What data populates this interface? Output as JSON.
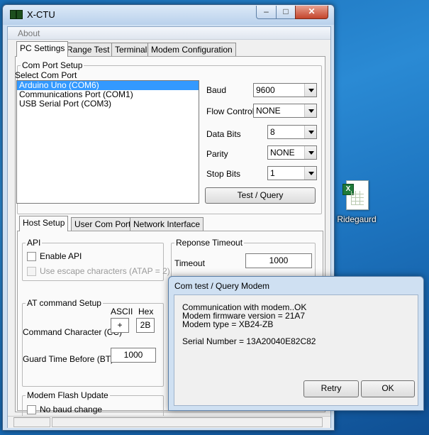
{
  "window": {
    "title": "X-CTU",
    "min_glyph": "–",
    "max_glyph": "□",
    "close_glyph": "✕"
  },
  "menu": {
    "about": "About"
  },
  "tabs": [
    "PC Settings",
    "Range Test",
    "Terminal",
    "Modem Configuration"
  ],
  "com_port_setup": {
    "legend": "Com Port Setup",
    "select_label": "Select Com Port",
    "ports": [
      "Arduino Uno (COM6)",
      "Communications Port (COM1)",
      "USB Serial Port (COM3)"
    ],
    "baud_label": "Baud",
    "baud_value": "9600",
    "flow_label": "Flow Control",
    "flow_value": "NONE",
    "databits_label": "Data Bits",
    "databits_value": "8",
    "parity_label": "Parity",
    "parity_value": "NONE",
    "stopbits_label": "Stop Bits",
    "stopbits_value": "1",
    "test_button": "Test  / Query"
  },
  "subtabs": [
    "Host Setup",
    "User Com Ports",
    "Network Interface"
  ],
  "api": {
    "legend": "API",
    "enable_api": "Enable API",
    "escape_chars": "Use escape characters (ATAP = 2)"
  },
  "response_timeout": {
    "legend": "Reponse Timeout",
    "timeout_label": "Timeout",
    "timeout_value": "1000"
  },
  "at_command": {
    "legend": "AT command Setup",
    "ascii_label": "ASCII",
    "hex_label": "Hex",
    "cc_label": "Command Character (CC)",
    "cc_ascii": "+",
    "cc_hex": "2B",
    "bt_label": "Guard Time Before (BT)",
    "bt_value": "1000"
  },
  "modem_flash": {
    "legend": "Modem Flash Update",
    "no_baud_change": "No baud change"
  },
  "dialog": {
    "title": "Com test / Query Modem",
    "lines": [
      "Communication with modem..OK",
      "Modem firmware version = 21A7",
      "Modem type = XB24-ZB",
      "",
      "Serial Number = 13A20040E82C82"
    ],
    "retry": "Retry",
    "ok": "OK"
  },
  "desktop_icon": {
    "label": "Ridegaurd",
    "badge": "X"
  }
}
